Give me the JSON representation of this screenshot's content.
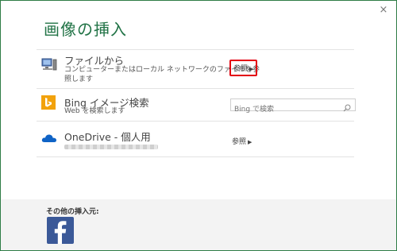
{
  "dialog": {
    "title": "画像の挿入",
    "close_glyph": "×"
  },
  "sources": {
    "file": {
      "title": "ファイルから",
      "description_line1": "コンピューターまたはローカル ネットワークのファイルを参",
      "description_line2": "照します",
      "browse_label": "参照",
      "icon": "computer-icon"
    },
    "bing": {
      "title": "Bing イメージ検索",
      "description": "Web を検索します",
      "search_placeholder": "Bing で検索",
      "icon": "bing-icon"
    },
    "onedrive": {
      "title": "OneDrive - 個人用",
      "browse_label": "参照",
      "icon": "cloud-icon"
    }
  },
  "footer": {
    "label": "その他の挿入元:",
    "facebook_icon": "facebook-icon"
  },
  "colors": {
    "accent": "#217346",
    "highlight": "#e3000f",
    "bing": "#f2a20c",
    "onedrive": "#0f63c6",
    "facebook": "#3b5998"
  }
}
